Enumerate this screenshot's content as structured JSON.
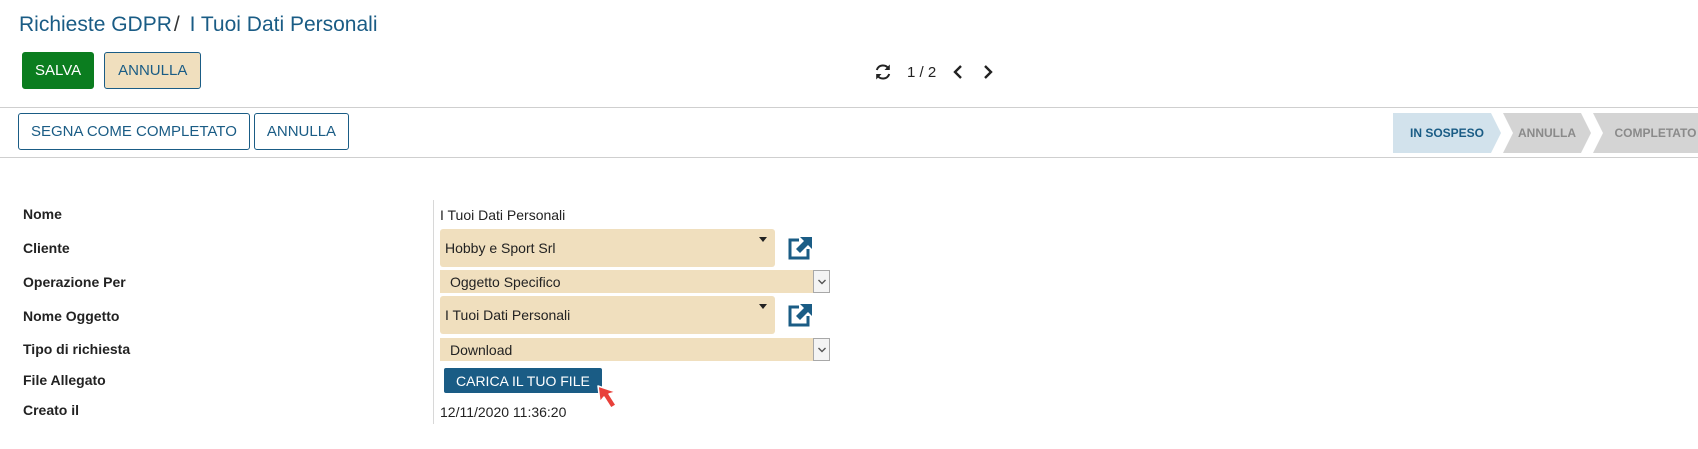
{
  "breadcrumb": {
    "parent": "Richieste GDPR",
    "separator": "/",
    "current": "I Tuoi Dati Personali"
  },
  "top_buttons": {
    "save": "SALVA",
    "cancel": "ANNULLA"
  },
  "pager": {
    "counter": "1 / 2",
    "refresh_icon": "refresh-icon",
    "prev_icon": "chevron-left-icon",
    "next_icon": "chevron-right-icon"
  },
  "status_buttons": {
    "mark_complete": "SEGNA COME COMPLETATO",
    "cancel": "ANNULLA"
  },
  "stages": [
    {
      "label": "IN SOSPESO",
      "active": true
    },
    {
      "label": "ANNULLA",
      "active": false
    },
    {
      "label": "COMPLETATO",
      "active": false
    }
  ],
  "form": {
    "nome": {
      "label": "Nome",
      "value": "I Tuoi Dati Personali"
    },
    "cliente": {
      "label": "Cliente",
      "value": "Hobby e Sport Srl"
    },
    "operazione_per": {
      "label": "Operazione Per",
      "value": "Oggetto Specifico"
    },
    "nome_oggetto": {
      "label": "Nome Oggetto",
      "value": "I Tuoi Dati Personali"
    },
    "tipo_richiesta": {
      "label": "Tipo di richiesta",
      "value": "Download"
    },
    "file_allegato": {
      "label": "File Allegato",
      "button": "CARICA IL TUO FILE"
    },
    "creato_il": {
      "label": "Creato il",
      "value": "12/11/2020 11:36:20"
    }
  },
  "colors": {
    "primary": "#1a5c85",
    "save_green": "#0b7d1f",
    "field_bg": "#f0dfbe",
    "stage_active": "#d2e2ec",
    "stage_inactive": "#d4d4d4",
    "cursor_red": "#e8403a"
  }
}
